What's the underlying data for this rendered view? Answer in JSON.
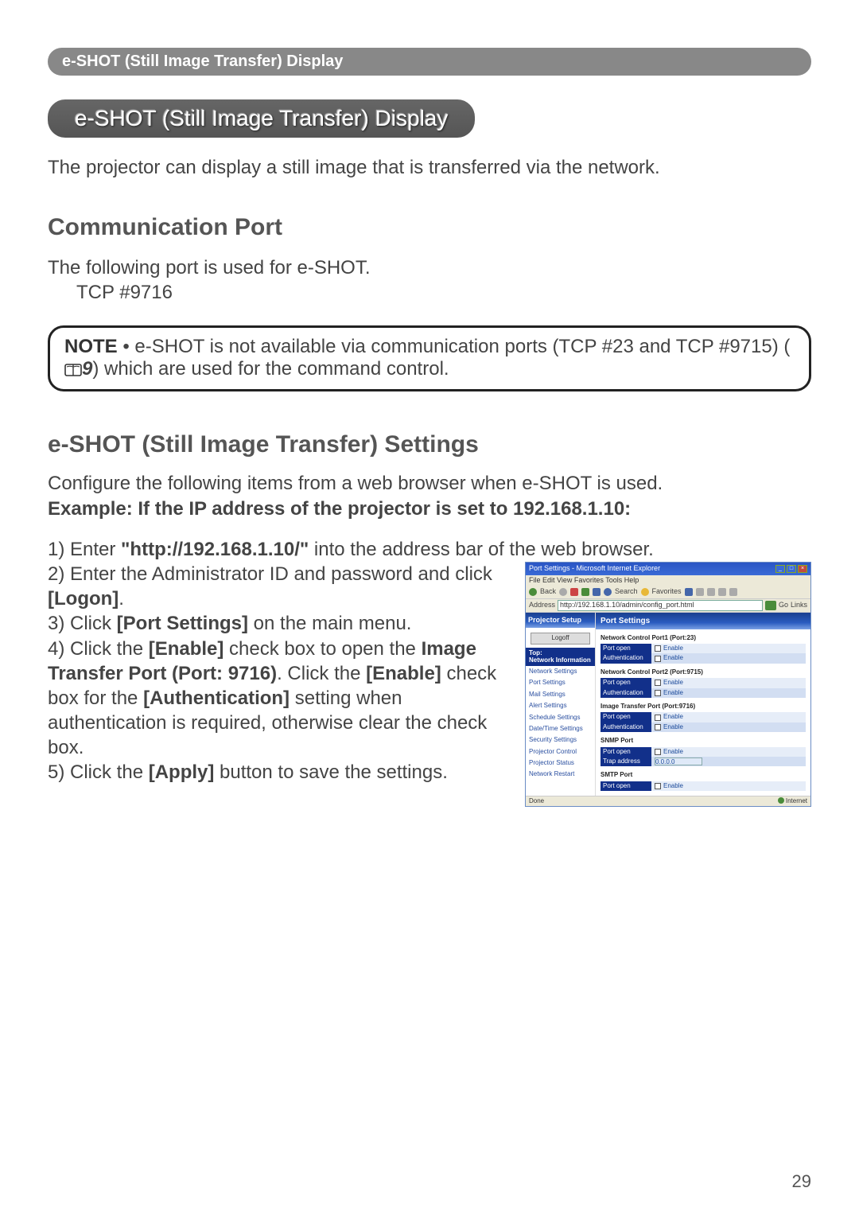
{
  "header_bar": "e-SHOT (Still Image Transfer) Display",
  "title_band": "e-SHOT (Still Image Transfer) Display",
  "intro": "The projector can display a still image that is transferred via the network.",
  "section1_title": "Communication Port",
  "section1_text": "The following port is used for e-SHOT.",
  "section1_port": "TCP #9716",
  "note_label": "NOTE",
  "note_body_1": " • e-SHOT is not available via communication ports (TCP #23 and TCP #9715) (",
  "note_ref": "9",
  "note_body_2": ") which are used for the command control.",
  "section2_title": "e-SHOT (Still Image Transfer) Settings",
  "config_line1": "Configure the following items from a web browser when e-SHOT is used.",
  "config_line2": "Example: If the IP address of the projector is set to 192.168.1.10:",
  "steps": {
    "s1a": "1) Enter ",
    "s1b": "\"http://192.168.1.10/\"",
    "s1c": " into the address bar of the web browser.",
    "s2a": "2) Enter the Administrator ID and password and click ",
    "s2b": "[Logon]",
    "s2c": ".",
    "s3a": "3) Click ",
    "s3b": "[Port Settings]",
    "s3c": " on the main menu.",
    "s4a": "4) Click the ",
    "s4b": "[Enable]",
    "s4c": " check box to open the ",
    "s4d": "Image Transfer Port (Port: 9716)",
    "s4e": ". Click the ",
    "s4f": "[Enable]",
    "s4g": " check box for the ",
    "s4h": "[Authentication]",
    "s4i": " setting when authentication is required, otherwise clear the check box.",
    "s5a": "5) Click the ",
    "s5b": "[Apply]",
    "s5c": " button to save the settings."
  },
  "browser": {
    "title": "Port Settings - Microsoft Internet Explorer",
    "menus": "File   Edit   View   Favorites   Tools   Help",
    "toolbar_back": "Back",
    "toolbar_search": "Search",
    "toolbar_fav": "Favorites",
    "address_label": "Address",
    "address_url": "http://192.168.1.10/admin/config_port.html",
    "go": "Go",
    "links": "Links",
    "sidebar_header": "Projector Setup",
    "logoff": "Logoff",
    "side_top": "Top:",
    "side_net_info": "Network Information",
    "side_items": [
      "Network Settings",
      "Port Settings",
      "Mail Settings",
      "Alert Settings",
      "Schedule Settings",
      "Date/Time Settings",
      "Security Settings",
      "Projector Control",
      "Projector Status",
      "Network Restart"
    ],
    "main_header": "Port Settings",
    "sec_a": "Network Control Port1 (Port:23)",
    "sec_b": "Network Control Port2 (Port:9715)",
    "sec_c": "Image Transfer Port (Port:9716)",
    "sec_d": "SNMP Port",
    "sec_e": "SMTP Port",
    "row_port_open": "Port open",
    "row_auth": "Authentication",
    "row_trap": "Trap address",
    "enable": "Enable",
    "trap_val": "0.0.0.0",
    "status_done": "Done",
    "status_internet": "Internet"
  },
  "page_number": "29"
}
